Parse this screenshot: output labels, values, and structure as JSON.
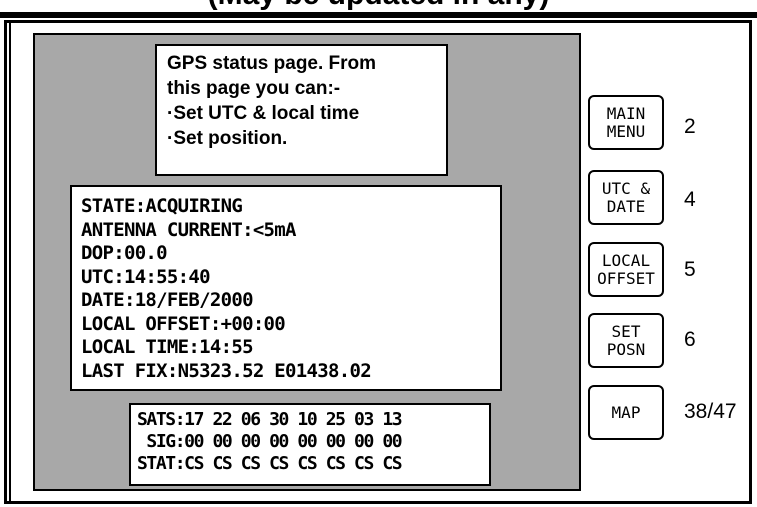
{
  "page": {
    "heading": "(May be updated in any)"
  },
  "help": {
    "lines": [
      "GPS status page. From",
      "this page you can:-",
      "·Set UTC & local time",
      "·Set position."
    ]
  },
  "status": {
    "lines": [
      "STATE:ACQUIRING",
      "ANTENNA CURRENT:<5mA",
      "DOP:00.0",
      "UTC:14:55:40",
      "DATE:18/FEB/2000",
      "LOCAL OFFSET:+00:00",
      "LOCAL TIME:14:55",
      "LAST FIX:N5323.52 E01438.02"
    ]
  },
  "sats": {
    "sats_line": "SATS:17 22 06 30 10 25 03 13",
    "sig_line": " SIG:00 00 00 00 00 00 00 00",
    "stat_line": "STAT:CS CS CS CS CS CS CS CS"
  },
  "buttons": [
    {
      "line1": "MAIN",
      "line2": "MENU",
      "key": "2"
    },
    {
      "line1": "UTC &",
      "line2": "DATE",
      "key": "4"
    },
    {
      "line1": "LOCAL",
      "line2": "OFFSET",
      "key": "5"
    },
    {
      "line1": "SET",
      "line2": "POSN",
      "key": "6"
    },
    {
      "line1": "MAP",
      "line2": "",
      "key": "38/47"
    }
  ],
  "colors": {
    "screen_background": "#a8a8a8",
    "panel_background": "#ffffff",
    "text": "#000000"
  }
}
